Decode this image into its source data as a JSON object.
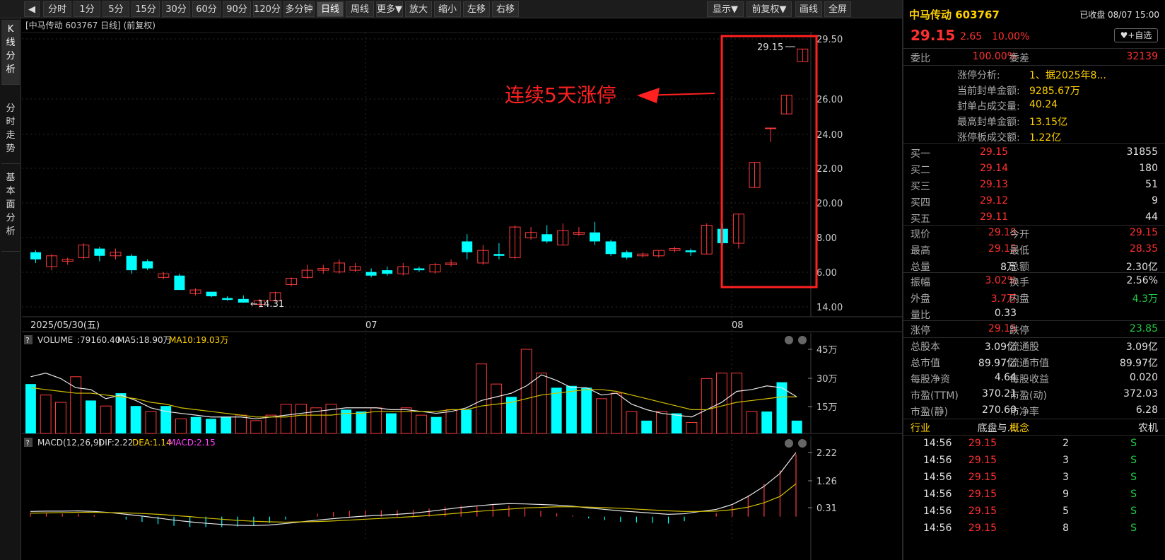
{
  "toolbar": {
    "back_icon": "◀",
    "periods": [
      "分时",
      "1分",
      "5分",
      "15分",
      "30分",
      "60分",
      "90分",
      "120分",
      "多分钟",
      "日线",
      "周线",
      "更多▼",
      "放大",
      "缩小",
      "左移",
      "右移"
    ],
    "active_period": "日线",
    "right_buttons": [
      "显示▼",
      "前复权▼",
      "画线",
      "全屏"
    ]
  },
  "side_tabs": [
    {
      "label": "K\n线\n分\n析",
      "active": true
    },
    {
      "label": "分\n时\n走\n势",
      "active": false
    },
    {
      "label": "基\n本\n面\n分\n析",
      "active": false
    }
  ],
  "main": {
    "title": "[中马传动 603767 日线] (前复权)",
    "date_label": "2025/05/30(五)",
    "month_labels": [
      "07",
      "08"
    ],
    "y_ticks": [
      "29.50",
      "26.00",
      "24.00",
      "22.00",
      "20.00",
      "8.00",
      "6.00",
      "14.00"
    ],
    "high_label": "29.15",
    "low_label": "14.31",
    "annotation": "连续5天涨停",
    "annotation_color": "#ff2020"
  },
  "volume_panel": {
    "question": "?",
    "label": "VOLUME",
    "value": ":79160.40",
    "ma5": "MA5:18.90万",
    "ma10": "MA10:19.03万",
    "y_ticks": [
      "45万",
      "30万",
      "15万"
    ]
  },
  "macd_panel": {
    "question": "?",
    "label": "MACD(12,26,9)",
    "dif": "DIF:2.22",
    "dea": "DEA:1.14",
    "macd": "MACD:2.15",
    "y_ticks": [
      "2.22",
      "1.26",
      "0.31"
    ]
  },
  "chart_data": {
    "type": "candlestick",
    "candles": [
      [
        16.4,
        16.0,
        15.8,
        16.5,
        "d"
      ],
      [
        15.6,
        16.2,
        15.4,
        16.3,
        "u"
      ],
      [
        15.9,
        16.0,
        15.7,
        16.1,
        "u"
      ],
      [
        16.1,
        16.8,
        16.0,
        16.9,
        "u"
      ],
      [
        16.6,
        16.2,
        15.9,
        16.7,
        "d"
      ],
      [
        16.2,
        16.4,
        16.0,
        16.6,
        "u"
      ],
      [
        16.2,
        15.4,
        15.2,
        16.3,
        "d"
      ],
      [
        15.9,
        15.5,
        15.4,
        16.0,
        "d"
      ],
      [
        15.2,
        15.0,
        14.9,
        15.3,
        "u"
      ],
      [
        15.1,
        14.3,
        14.3,
        15.2,
        "d"
      ],
      [
        14.3,
        14.1,
        14.0,
        14.4,
        "u"
      ],
      [
        14.2,
        13.95,
        13.9,
        14.2,
        "d"
      ],
      [
        13.85,
        13.75,
        13.7,
        13.95,
        "d"
      ],
      [
        13.8,
        13.6,
        13.6,
        14.0,
        "d"
      ],
      [
        13.5,
        13.7,
        13.3,
        13.8,
        "u"
      ],
      [
        13.7,
        14.15,
        13.65,
        14.2,
        "u"
      ],
      [
        14.6,
        14.95,
        14.5,
        15.0,
        "u"
      ],
      [
        15.0,
        15.4,
        14.9,
        15.7,
        "u"
      ],
      [
        15.4,
        15.5,
        15.2,
        15.7,
        "u"
      ],
      [
        15.3,
        15.8,
        15.2,
        16.0,
        "u"
      ],
      [
        15.4,
        15.6,
        15.3,
        15.8,
        "u"
      ],
      [
        15.3,
        15.1,
        15.0,
        15.5,
        "d"
      ],
      [
        15.4,
        15.2,
        15.1,
        15.6,
        "d"
      ],
      [
        15.2,
        15.6,
        15.1,
        15.8,
        "u"
      ],
      [
        15.5,
        15.4,
        15.3,
        15.6,
        "d"
      ],
      [
        15.3,
        15.7,
        15.2,
        15.8,
        "u"
      ],
      [
        15.7,
        15.8,
        15.6,
        16.0,
        "u"
      ],
      [
        17.0,
        16.4,
        16.0,
        17.4,
        "d"
      ],
      [
        15.8,
        16.5,
        15.7,
        16.8,
        "u"
      ],
      [
        16.3,
        16.2,
        16.0,
        16.9,
        "d"
      ],
      [
        16.1,
        17.8,
        16.0,
        17.9,
        "u"
      ],
      [
        17.2,
        17.5,
        17.1,
        17.8,
        "u"
      ],
      [
        17.4,
        17.0,
        16.9,
        17.9,
        "d"
      ],
      [
        16.8,
        17.6,
        16.8,
        18.0,
        "u"
      ],
      [
        17.5,
        17.4,
        17.3,
        17.8,
        "u"
      ],
      [
        17.5,
        17.0,
        16.8,
        18.1,
        "d"
      ],
      [
        17.0,
        16.3,
        16.2,
        17.1,
        "d"
      ],
      [
        16.4,
        16.1,
        16.0,
        16.5,
        "d"
      ],
      [
        16.2,
        16.3,
        16.1,
        16.4,
        "u"
      ],
      [
        16.2,
        16.5,
        16.1,
        16.5,
        "u"
      ],
      [
        16.5,
        16.6,
        16.4,
        16.7,
        "u"
      ],
      [
        16.5,
        16.4,
        16.2,
        16.6,
        "d"
      ],
      [
        16.3,
        17.9,
        16.3,
        18.0,
        "u"
      ],
      [
        17.7,
        16.9,
        16.8,
        18.0,
        "d"
      ],
      [
        16.9,
        18.6,
        16.6,
        18.6,
        "u"
      ],
      [
        20.3,
        21.9,
        20.3,
        21.9,
        "u"
      ],
      [
        24.1,
        24.1,
        23.2,
        24.1,
        "u"
      ],
      [
        25.0,
        26.2,
        25.0,
        26.2,
        "u"
      ],
      [
        28.35,
        29.15,
        28.35,
        29.15,
        "u"
      ]
    ],
    "volumes": [
      27,
      21,
      17,
      31,
      18,
      15,
      22,
      15,
      12,
      15,
      8,
      9,
      8,
      9,
      10,
      7,
      10,
      16,
      16,
      14,
      16,
      13,
      12,
      14,
      11,
      14,
      10,
      9,
      13,
      13,
      38,
      27,
      20,
      46,
      33,
      25,
      26,
      25,
      19,
      22,
      12,
      7,
      12,
      11,
      6,
      30,
      33,
      33,
      12,
      12,
      28,
      7
    ],
    "ma5_line": [
      31,
      33,
      30,
      25,
      24,
      19,
      21,
      18,
      14,
      12,
      11,
      10,
      9,
      9,
      9,
      8,
      9,
      10,
      11,
      12,
      13,
      14,
      14,
      14,
      13,
      13,
      12,
      11,
      12,
      14,
      18,
      20,
      22,
      26,
      32,
      29,
      25,
      25,
      21,
      22,
      16,
      13,
      11,
      10,
      9,
      13,
      17,
      23,
      24,
      26,
      25,
      20
    ],
    "ma10_line": [
      25,
      24,
      23,
      22,
      22,
      21,
      20,
      19,
      17,
      16,
      14,
      13,
      12,
      11,
      10,
      9,
      9,
      9,
      10,
      10,
      10,
      11,
      11,
      12,
      12,
      12,
      12,
      12,
      13,
      13,
      15,
      16,
      17,
      19,
      21,
      22,
      23,
      24,
      24,
      23,
      21,
      19,
      17,
      15,
      13,
      13,
      15,
      17,
      18,
      19,
      20,
      20
    ],
    "dif_line": [
      0.18,
      0.19,
      0.19,
      0.2,
      0.18,
      0.14,
      0.08,
      0.02,
      -0.05,
      -0.12,
      -0.18,
      -0.23,
      -0.27,
      -0.3,
      -0.31,
      -0.29,
      -0.24,
      -0.18,
      -0.12,
      -0.07,
      -0.02,
      0.02,
      0.05,
      0.08,
      0.12,
      0.18,
      0.25,
      0.32,
      0.37,
      0.42,
      0.45,
      0.44,
      0.42,
      0.4,
      0.36,
      0.3,
      0.25,
      0.2,
      0.16,
      0.12,
      0.08,
      0.1,
      0.18,
      0.25,
      0.42,
      0.7,
      1.05,
      1.5,
      2.22
    ],
    "dea_line": [
      0.12,
      0.13,
      0.14,
      0.15,
      0.15,
      0.14,
      0.13,
      0.11,
      0.08,
      0.04,
      0.0,
      -0.05,
      -0.09,
      -0.13,
      -0.16,
      -0.18,
      -0.19,
      -0.18,
      -0.17,
      -0.15,
      -0.12,
      -0.09,
      -0.06,
      -0.03,
      0.0,
      0.04,
      0.08,
      0.13,
      0.18,
      0.22,
      0.26,
      0.3,
      0.32,
      0.34,
      0.34,
      0.33,
      0.31,
      0.29,
      0.26,
      0.23,
      0.2,
      0.18,
      0.18,
      0.19,
      0.24,
      0.33,
      0.48,
      0.7,
      1.14
    ]
  },
  "info": {
    "name": "中马传动 603767",
    "status": "已收盘 08/07 15:00",
    "price": "29.15",
    "change": "2.65",
    "pct": "10.00%",
    "watch_btn": "+自选",
    "weibi_label": "委比",
    "weibi": "100.00%",
    "weicha_label": "委差",
    "weicha": "32139",
    "limit_analysis": [
      {
        "k": "涨停分析:",
        "v": "1、据2025年8..."
      },
      {
        "k": "当前封单金额:",
        "v": "9285.67万"
      },
      {
        "k": "封单占成交量:",
        "v": "40.24"
      },
      {
        "k": "最高封单金额:",
        "v": "13.15亿"
      },
      {
        "k": "涨停板成交额:",
        "v": "1.22亿"
      }
    ],
    "bids": [
      {
        "k": "买一",
        "p": "29.15",
        "v": "31855"
      },
      {
        "k": "买二",
        "p": "29.14",
        "v": "180"
      },
      {
        "k": "买三",
        "p": "29.13",
        "v": "51"
      },
      {
        "k": "买四",
        "p": "29.12",
        "v": "9"
      },
      {
        "k": "买五",
        "p": "29.11",
        "v": "44"
      }
    ],
    "quote": [
      [
        "现价",
        "29.15",
        "今开",
        "29.15"
      ],
      [
        "最高",
        "29.15",
        "最低",
        "28.35"
      ],
      [
        "总量",
        "8万",
        "总额",
        "2.30亿"
      ]
    ],
    "stats": [
      [
        "振幅",
        "3.02%",
        "换手",
        "2.56%"
      ],
      [
        "外盘",
        "3.7万",
        "内盘",
        "4.3万"
      ],
      [
        "量比",
        "0.33",
        "",
        ""
      ]
    ],
    "limits": [
      "涨停",
      "29.15",
      "跌停",
      "23.85"
    ],
    "fundamentals": [
      [
        "总股本",
        "3.09亿",
        "流通股",
        "3.09亿"
      ],
      [
        "总市值",
        "89.97亿",
        "流通市值",
        "89.97亿"
      ],
      [
        "每股净资",
        "4.64",
        "每股收益",
        "0.020"
      ],
      [
        "市盈(TTM)",
        "370.21",
        "市盈(动)",
        "372.03"
      ],
      [
        "市盈(静)",
        "270.60",
        "市净率",
        "6.28"
      ]
    ],
    "industry": [
      "行业",
      "底盘与...",
      "概念",
      "农机"
    ],
    "ticks": [
      [
        "14:56",
        "29.15",
        "2",
        "S"
      ],
      [
        "14:56",
        "29.15",
        "3",
        "S"
      ],
      [
        "14:56",
        "29.15",
        "3",
        "S"
      ],
      [
        "14:56",
        "29.15",
        "9",
        "S"
      ],
      [
        "14:56",
        "29.15",
        "5",
        "S"
      ],
      [
        "14:56",
        "29.15",
        "8",
        "S"
      ]
    ]
  }
}
